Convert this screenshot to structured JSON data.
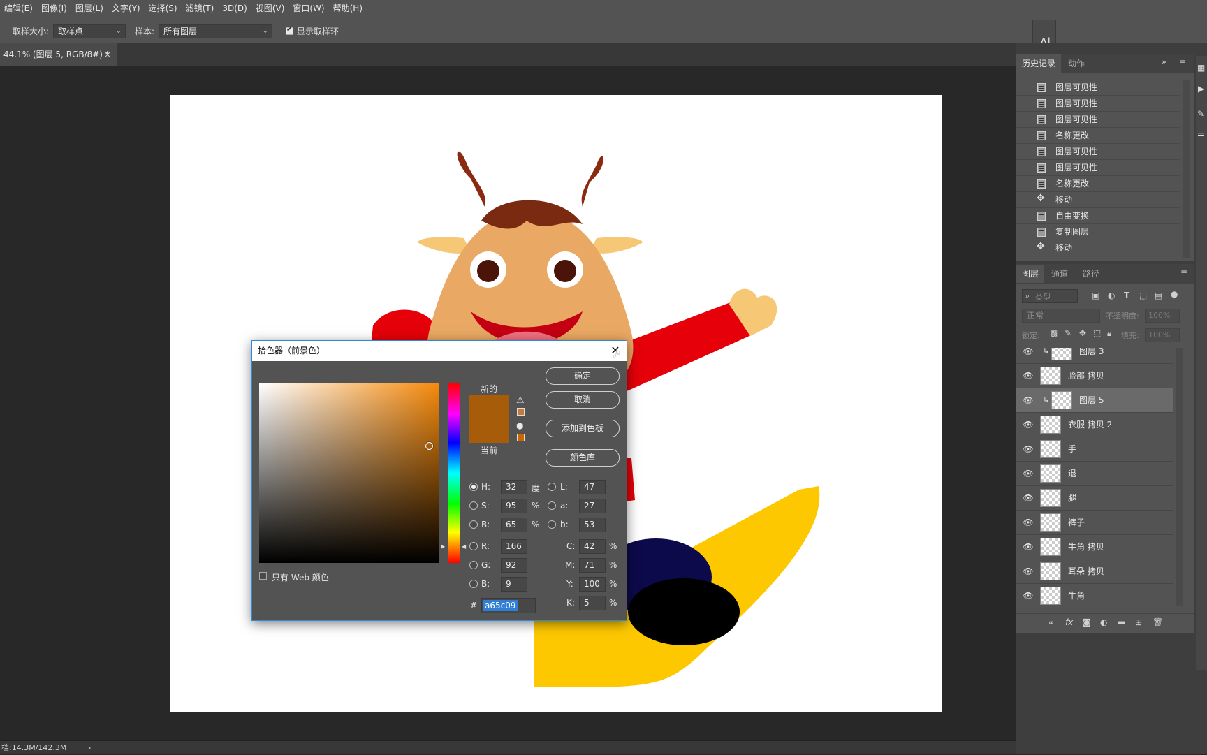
{
  "menu": [
    "编辑(E)",
    "图像(I)",
    "图层(L)",
    "文字(Y)",
    "选择(S)",
    "滤镜(T)",
    "3D(D)",
    "视图(V)",
    "窗口(W)",
    "帮助(H)"
  ],
  "options": {
    "sample_size_label": "取样大小:",
    "sample_size_value": "取样点",
    "sample_label": "样本:",
    "sample_value": "所有图层",
    "show_ring_label": "显示取样环"
  },
  "document_tab": {
    "title": "44.1% (图层 5, RGB/8#) *",
    "close": "×"
  },
  "status": {
    "doc": "档:14.3M/142.3M",
    "arrow": "›"
  },
  "history_panel": {
    "tabs": [
      "历史记录",
      "动作"
    ],
    "items": [
      {
        "label": "图层可见性",
        "icon": "doc-icon"
      },
      {
        "label": "图层可见性",
        "icon": "doc-icon"
      },
      {
        "label": "图层可见性",
        "icon": "doc-icon"
      },
      {
        "label": "名称更改",
        "icon": "doc-icon"
      },
      {
        "label": "图层可见性",
        "icon": "doc-icon"
      },
      {
        "label": "图层可见性",
        "icon": "doc-icon"
      },
      {
        "label": "名称更改",
        "icon": "doc-icon"
      },
      {
        "label": "移动",
        "icon": "move-icon"
      },
      {
        "label": "自由变换",
        "icon": "doc-icon"
      },
      {
        "label": "复制图层",
        "icon": "doc-icon"
      },
      {
        "label": "移动",
        "icon": "move-icon"
      }
    ]
  },
  "layers_panel": {
    "tabs": [
      "图层",
      "通道",
      "路径"
    ],
    "search_placeholder": "类型",
    "blend_mode": "正常",
    "opacity_label": "不透明度:",
    "opacity_value": "100%",
    "lock_label": "锁定:",
    "fill_label": "填充:",
    "fill_value": "100%",
    "layers": [
      {
        "name": "图层 3",
        "clipped": true,
        "strike": false,
        "selected": false
      },
      {
        "name": "脸部 拷贝",
        "clipped": false,
        "strike": true,
        "selected": false
      },
      {
        "name": "图层 5",
        "clipped": true,
        "strike": false,
        "selected": true
      },
      {
        "name": "衣服 拷贝 2",
        "clipped": false,
        "strike": true,
        "selected": false
      },
      {
        "name": "手",
        "clipped": false,
        "strike": false,
        "selected": false
      },
      {
        "name": "退",
        "clipped": false,
        "strike": false,
        "selected": false
      },
      {
        "name": "腿",
        "clipped": false,
        "strike": false,
        "selected": false
      },
      {
        "name": "裤子",
        "clipped": false,
        "strike": false,
        "selected": false
      },
      {
        "name": "牛角 拷贝",
        "clipped": false,
        "strike": false,
        "selected": false
      },
      {
        "name": "耳朵 拷贝",
        "clipped": false,
        "strike": false,
        "selected": false
      },
      {
        "name": "牛角",
        "clipped": false,
        "strike": false,
        "selected": false
      }
    ]
  },
  "color_picker": {
    "title": "拾色器（前景色）",
    "close": "✕",
    "new_label": "新的",
    "current_label": "当前",
    "ok": "确定",
    "cancel": "取消",
    "add_swatch": "添加到色板",
    "libraries": "颜色库",
    "web_only": "只有 Web 颜色",
    "color_hex": "#a65c09",
    "hsb": {
      "H": "32",
      "S": "95",
      "B": "65",
      "H_unit": "度",
      "S_unit": "%",
      "B_unit": "%"
    },
    "lab": {
      "L": "47",
      "a": "27",
      "b": "53"
    },
    "rgb": {
      "R": "166",
      "G": "92",
      "B": "9"
    },
    "cmyk": {
      "C": "42",
      "M": "71",
      "Y": "100",
      "K": "5",
      "unit": "%"
    },
    "hash": "#",
    "hex": "a65c09",
    "selected_mode": "H"
  }
}
